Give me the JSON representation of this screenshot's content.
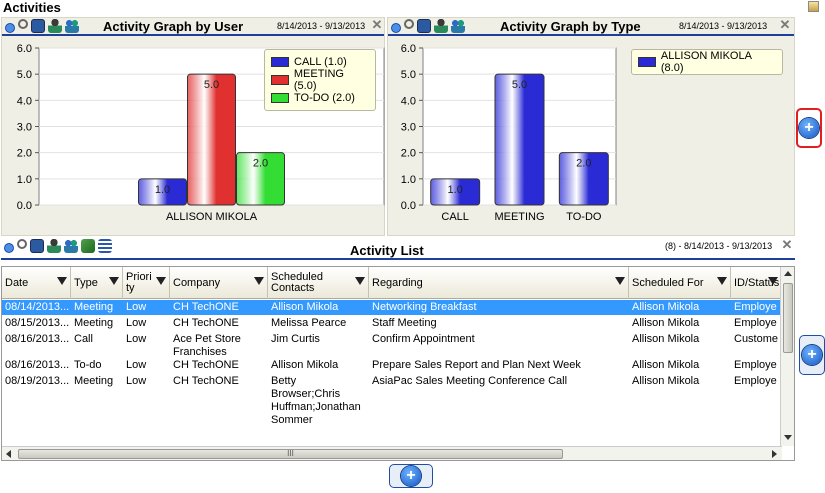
{
  "page": {
    "title": "Activities"
  },
  "panels": {
    "by_user": {
      "title": "Activity Graph by User",
      "dates": "8/14/2013 - 9/13/2013"
    },
    "by_type": {
      "title": "Activity Graph by Type",
      "dates": "8/14/2013 - 9/13/2013"
    },
    "list": {
      "title": "Activity List",
      "dates": "(8) - 8/14/2013 - 9/13/2013"
    }
  },
  "chart_data": [
    {
      "type": "bar",
      "title": "Activity Graph by User",
      "categories": [
        "ALLISON MIKOLA"
      ],
      "series": [
        {
          "name": "CALL (1.0)",
          "values": [
            1.0
          ],
          "color": "#2b2bd6"
        },
        {
          "name": "MEETING (5.0)",
          "values": [
            5.0
          ],
          "color": "#e03030"
        },
        {
          "name": "TO-DO (2.0)",
          "values": [
            2.0
          ],
          "color": "#33dd33"
        }
      ],
      "data_labels": [
        "1.0",
        "5.0",
        "2.0"
      ],
      "y_ticks": [
        "0.0",
        "1.0",
        "2.0",
        "3.0",
        "4.0",
        "5.0",
        "6.0"
      ],
      "ylim": [
        0,
        6
      ],
      "grid": true,
      "legend": "top-right"
    },
    {
      "type": "bar",
      "title": "Activity Graph by Type",
      "categories": [
        "CALL",
        "MEETING",
        "TO-DO"
      ],
      "series": [
        {
          "name": "ALLISON MIKOLA (8.0)",
          "values": [
            1.0,
            5.0,
            2.0
          ],
          "color": "#2b2bd6"
        }
      ],
      "data_labels": [
        "1.0",
        "5.0",
        "2.0"
      ],
      "y_ticks": [
        "0.0",
        "1.0",
        "2.0",
        "3.0",
        "4.0",
        "5.0",
        "6.0"
      ],
      "ylim": [
        0,
        6
      ],
      "grid": true,
      "legend": "top-right"
    }
  ],
  "table": {
    "columns": [
      "Date",
      "Type",
      "Priori\nty",
      "Company",
      "Scheduled\nContacts",
      "Regarding",
      "Scheduled For",
      "ID/Status"
    ],
    "rows": [
      [
        "08/14/2013...",
        "Meeting",
        "Low",
        "CH TechONE",
        "Allison Mikola",
        "Networking Breakfast",
        "Allison Mikola",
        "Employe"
      ],
      [
        "08/15/2013...",
        "Meeting",
        "Low",
        "CH TechONE",
        "Melissa Pearce",
        "Staff Meeting",
        "Allison Mikola",
        "Employe"
      ],
      [
        "08/16/2013...",
        "Call",
        "Low",
        "Ace Pet Store\nFranchises",
        "Jim Curtis",
        "Confirm Appointment",
        "Allison Mikola",
        "Custome"
      ],
      [
        "08/16/2013...",
        "To-do",
        "Low",
        "CH TechONE",
        "Allison Mikola",
        "Prepare Sales Report and Plan Next Week",
        "Allison Mikola",
        "Employe"
      ],
      [
        "08/19/2013...",
        "Meeting",
        "Low",
        "CH TechONE",
        "Betty\nBrowser;Chris\nHuffman;Jonathan\nSommer",
        "AsiaPac Sales Meeting Conference Call",
        "Allison Mikola",
        "Employe"
      ]
    ],
    "scroll_grip": "III"
  },
  "icons": [
    "add-icon",
    "search-icon",
    "monitor-icon",
    "user-icon",
    "users-icon",
    "export-icon",
    "list-icon",
    "close-icon",
    "filter-icon"
  ],
  "colors": {
    "header_rule": "#1f3f9a",
    "selected_row": "#3399ff",
    "side_add_highlight": "#e02020"
  }
}
